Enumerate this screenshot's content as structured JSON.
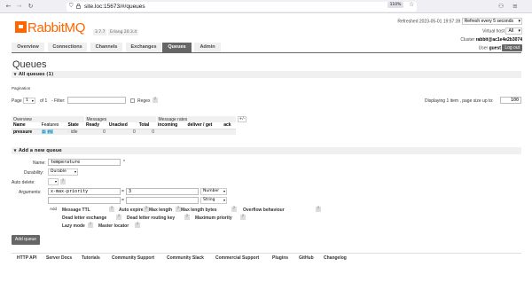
{
  "browser": {
    "url": "site.loc:15673/#/queues",
    "zoom": "110%"
  },
  "brand": {
    "name": "RabbitMQ",
    "version": "3.7.7",
    "erlang": "Erlang 20.3.4",
    "accent_color": "#ff6600"
  },
  "header": {
    "refreshed": "Refreshed 2023-05-01 19:57:39",
    "refresh_option": "Refresh every 5 seconds",
    "vhost_label": "Virtual host",
    "vhost_value": "All",
    "cluster_label": "Cluster",
    "cluster_value": "rabbit@ac1e4e2b3074",
    "user_label": "User",
    "user_value": "guest",
    "logout": "Log out"
  },
  "tabs": [
    "Overview",
    "Connections",
    "Channels",
    "Exchanges",
    "Queues",
    "Admin"
  ],
  "page_title": "Queues",
  "all_queues": {
    "header": "All queues (1)",
    "pagination_label": "Pagination",
    "page_label": "Page",
    "page_value": "1",
    "of_label": "of 1",
    "filter_label": "- Filter:",
    "regex_label": "Regex",
    "help": "?",
    "displaying": "Displaying 1 item , page size up to:",
    "page_size": "100",
    "plus_minus": "+/-",
    "groups": [
      "Overview",
      "Messages",
      "Message rates"
    ],
    "columns": [
      "Name",
      "Features",
      "State",
      "Ready",
      "Unacked",
      "Total",
      "incoming",
      "deliver / get",
      "ack"
    ],
    "rows": [
      {
        "name": "pressure",
        "features": [
          "D",
          "Pri"
        ],
        "state": "idle",
        "ready": "0",
        "unacked": "0",
        "total": "0",
        "incoming": "",
        "deliver_get": "",
        "ack": ""
      }
    ]
  },
  "add_queue": {
    "header": "Add a new queue",
    "name_label": "Name:",
    "name_value": "temperature",
    "required_mark": "*",
    "durability_label": "Durability:",
    "durability_value": "Durable",
    "autodelete_label": "Auto delete:",
    "arguments_label": "Arguments:",
    "arg1_key": "x-max-priority",
    "eq": "=",
    "arg1_value": "3",
    "arg1_type": "Number",
    "arg2_type": "String",
    "add_label": "Add",
    "chips_row1": [
      "Message TTL",
      "Auto expire",
      "Max length",
      "Max length bytes",
      "Overflow behaviour"
    ],
    "chips_row2": [
      "Dead letter exchange",
      "Dead letter routing key",
      "Maximum priority"
    ],
    "chips_row3": [
      "Lazy mode",
      "Master locator"
    ],
    "submit": "Add queue"
  },
  "footer": [
    "HTTP API",
    "Server Docs",
    "Tutorials",
    "Community Support",
    "Community Slack",
    "Commercial Support",
    "Plugins",
    "GitHub",
    "Changelog"
  ]
}
